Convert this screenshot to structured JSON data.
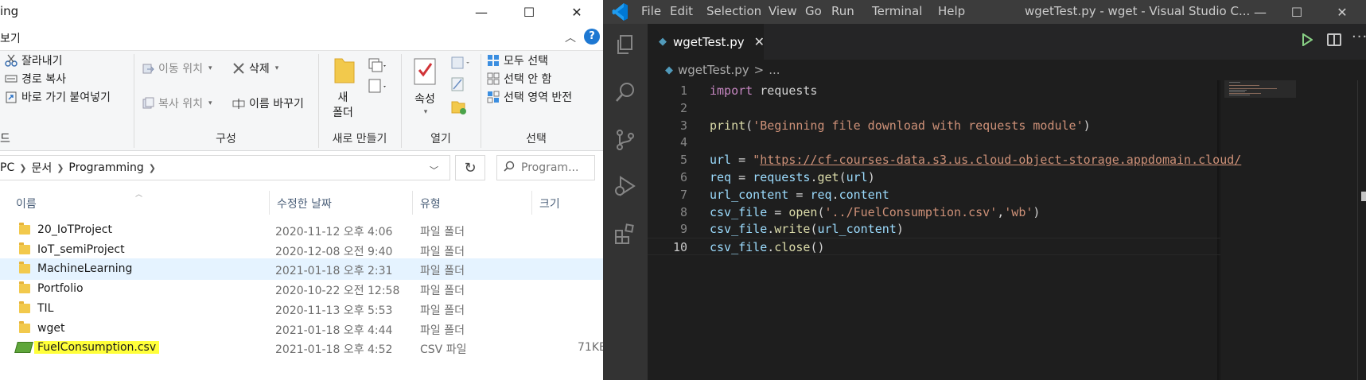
{
  "explorer": {
    "title_fragment": "ing",
    "window_buttons": {
      "minimize": "—",
      "maximize": "☐",
      "close": "✕"
    },
    "menu": {
      "view": "보기"
    },
    "ribbon": {
      "clipboard": {
        "cut": "잘라내기",
        "copy_path": "경로 복사",
        "paste_shortcut": "바로 가기 붙여넣기",
        "group_label": "드"
      },
      "organize": {
        "move_to": "이동 위치",
        "copy_to": "복사 위치",
        "delete": "삭제",
        "rename": "이름 바꾸기",
        "group_label": "구성"
      },
      "new": {
        "new_folder_line1": "새",
        "new_folder_line2": "폴더",
        "group_label": "새로 만들기"
      },
      "open": {
        "properties": "속성",
        "group_label": "열기"
      },
      "select": {
        "select_all": "모두 선택",
        "select_none": "선택 안 함",
        "invert_selection": "선택 영역 반전",
        "group_label": "선택"
      }
    },
    "address": {
      "crumbs": [
        "PC",
        "문서",
        "Programming"
      ],
      "search_placeholder": "Program..."
    },
    "columns": {
      "name": "이름",
      "date": "수정한 날짜",
      "type": "유형",
      "size": "크기"
    },
    "files": [
      {
        "name": "20_IoTProject",
        "date": "2020-11-12 오후 4:06",
        "type": "파일 폴더",
        "size": "",
        "kind": "folder"
      },
      {
        "name": "IoT_semiProject",
        "date": "2020-12-08 오전 9:40",
        "type": "파일 폴더",
        "size": "",
        "kind": "folder"
      },
      {
        "name": "MachineLearning",
        "date": "2021-01-18 오후 2:31",
        "type": "파일 폴더",
        "size": "",
        "kind": "folder",
        "selected": true
      },
      {
        "name": "Portfolio",
        "date": "2020-10-22 오전 12:58",
        "type": "파일 폴더",
        "size": "",
        "kind": "folder"
      },
      {
        "name": "TIL",
        "date": "2020-11-13 오후 5:53",
        "type": "파일 폴더",
        "size": "",
        "kind": "folder"
      },
      {
        "name": "wget",
        "date": "2021-01-18 오후 4:44",
        "type": "파일 폴더",
        "size": "",
        "kind": "folder"
      },
      {
        "name": "FuelConsumption.csv",
        "date": "2021-01-18 오후 4:52",
        "type": "CSV 파일",
        "size": "71KB",
        "kind": "csv",
        "highlight": true
      }
    ]
  },
  "vscode": {
    "menu": [
      "File",
      "Edit",
      "Selection",
      "View",
      "Go",
      "Run",
      "Terminal",
      "Help"
    ],
    "window_title": "wgetTest.py - wget - Visual Studio C...",
    "tab": {
      "label": "wgetTest.py",
      "close": "✕"
    },
    "breadcrumb": {
      "file": "wgetTest.py",
      "sep": ">",
      "rest": "..."
    },
    "more_label": "···",
    "lines": [
      {
        "n": "1",
        "segs": [
          [
            "kw",
            "import"
          ],
          [
            "txt",
            " requests"
          ]
        ]
      },
      {
        "n": "2",
        "segs": []
      },
      {
        "n": "3",
        "segs": [
          [
            "fn",
            "print"
          ],
          [
            "txt",
            "("
          ],
          [
            "str",
            "'Beginning file download with requests module'"
          ],
          [
            "txt",
            ")"
          ]
        ]
      },
      {
        "n": "4",
        "segs": []
      },
      {
        "n": "5",
        "segs": [
          [
            "var",
            "url"
          ],
          [
            "txt",
            " = "
          ],
          [
            "str",
            "\""
          ],
          [
            "url",
            "https://cf-courses-data.s3.us.cloud-object-storage.appdomain.cloud/"
          ]
        ]
      },
      {
        "n": "6",
        "segs": [
          [
            "var",
            "req"
          ],
          [
            "txt",
            " = "
          ],
          [
            "var",
            "requests"
          ],
          [
            "txt",
            "."
          ],
          [
            "fn",
            "get"
          ],
          [
            "txt",
            "("
          ],
          [
            "var",
            "url"
          ],
          [
            "txt",
            ")"
          ]
        ]
      },
      {
        "n": "7",
        "segs": [
          [
            "var",
            "url_content"
          ],
          [
            "txt",
            " = "
          ],
          [
            "var",
            "req"
          ],
          [
            "txt",
            "."
          ],
          [
            "var",
            "content"
          ]
        ]
      },
      {
        "n": "8",
        "segs": [
          [
            "var",
            "csv_file"
          ],
          [
            "txt",
            " = "
          ],
          [
            "fn",
            "open"
          ],
          [
            "txt",
            "("
          ],
          [
            "str",
            "'../FuelConsumption.csv'"
          ],
          [
            "txt",
            ","
          ],
          [
            "str",
            "'wb'"
          ],
          [
            "txt",
            ")"
          ]
        ]
      },
      {
        "n": "9",
        "segs": [
          [
            "var",
            "csv_file"
          ],
          [
            "txt",
            "."
          ],
          [
            "fn",
            "write"
          ],
          [
            "txt",
            "("
          ],
          [
            "var",
            "url_content"
          ],
          [
            "txt",
            ")"
          ]
        ]
      },
      {
        "n": "10",
        "segs": [
          [
            "var",
            "csv_file"
          ],
          [
            "txt",
            "."
          ],
          [
            "fn",
            "close"
          ],
          [
            "txt",
            "()"
          ]
        ],
        "current": true
      }
    ]
  }
}
